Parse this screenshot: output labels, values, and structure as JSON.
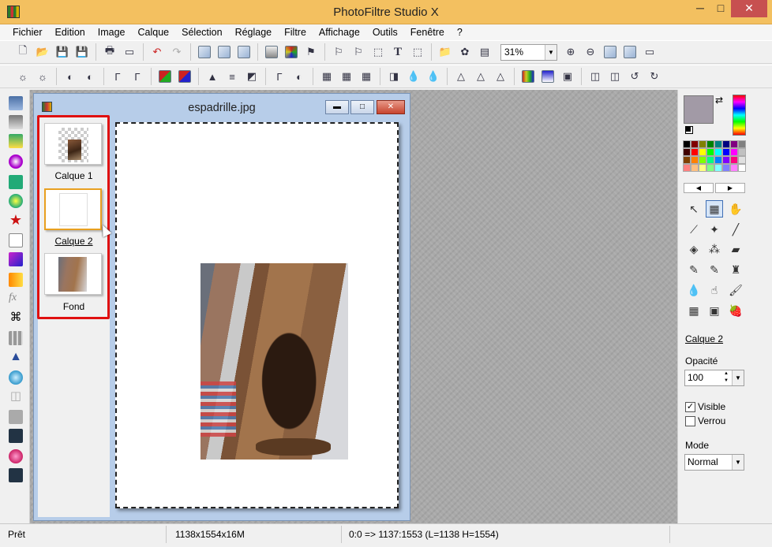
{
  "app": {
    "title": "PhotoFiltre Studio X",
    "window_buttons": {
      "minimize": "─",
      "maximize": "□",
      "close": "✕"
    }
  },
  "menu": [
    "Fichier",
    "Edition",
    "Image",
    "Calque",
    "Sélection",
    "Réglage",
    "Filtre",
    "Affichage",
    "Outils",
    "Fenêtre",
    "?"
  ],
  "toolbar": {
    "zoom_value": "31%",
    "text_tool_glyph": "T"
  },
  "document": {
    "title": "espadrille.jpg",
    "layers": [
      {
        "label": "Calque 1"
      },
      {
        "label": "Calque 2",
        "selected": true
      },
      {
        "label": "Fond"
      }
    ]
  },
  "right_panel": {
    "current_layer": "Calque 2",
    "opacity_label": "Opacité",
    "opacity_value": "100",
    "visible_label": "Visible",
    "visible_checked": "✓",
    "lock_label": "Verrou",
    "mode_label": "Mode",
    "mode_value": "Normal",
    "foreground_color": "#a29aa6",
    "palette": [
      "#000000",
      "#800000",
      "#808000",
      "#008000",
      "#008080",
      "#000080",
      "#800080",
      "#808080",
      "#400000",
      "#ff0000",
      "#ffff00",
      "#00ff00",
      "#00ffff",
      "#0000ff",
      "#ff00ff",
      "#c0c0c0",
      "#804000",
      "#ff8000",
      "#80ff00",
      "#00ff80",
      "#0080ff",
      "#8000ff",
      "#ff0080",
      "#e0e0e0",
      "#ff8080",
      "#ffc080",
      "#ffff80",
      "#80ff80",
      "#80ffff",
      "#8080ff",
      "#ff80ff",
      "#ffffff"
    ]
  },
  "status": {
    "state": "Prêt",
    "image_info": "1138x1554x16M",
    "coords": "0:0 => 1137:1553 (L=1138  H=1554)"
  }
}
